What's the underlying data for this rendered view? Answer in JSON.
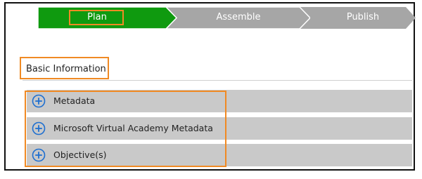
{
  "wizard": {
    "steps": [
      {
        "label": "Plan",
        "state": "active",
        "color": "#0f9a0f"
      },
      {
        "label": "Assemble",
        "state": "inactive",
        "color": "#a6a6a6"
      },
      {
        "label": "Publish",
        "state": "inactive",
        "color": "#a6a6a6"
      }
    ]
  },
  "section": {
    "heading": "Basic Information"
  },
  "accordion": {
    "items": [
      {
        "label": "Metadata",
        "icon": "plus-circle-icon"
      },
      {
        "label": "Microsoft Virtual Academy Metadata",
        "icon": "plus-circle-icon"
      },
      {
        "label": "Objective(s)",
        "icon": "plus-circle-icon"
      }
    ]
  },
  "colors": {
    "highlight": "#f08a24",
    "accent_blue": "#1e6fd0",
    "row_background": "#c9c9c9"
  }
}
